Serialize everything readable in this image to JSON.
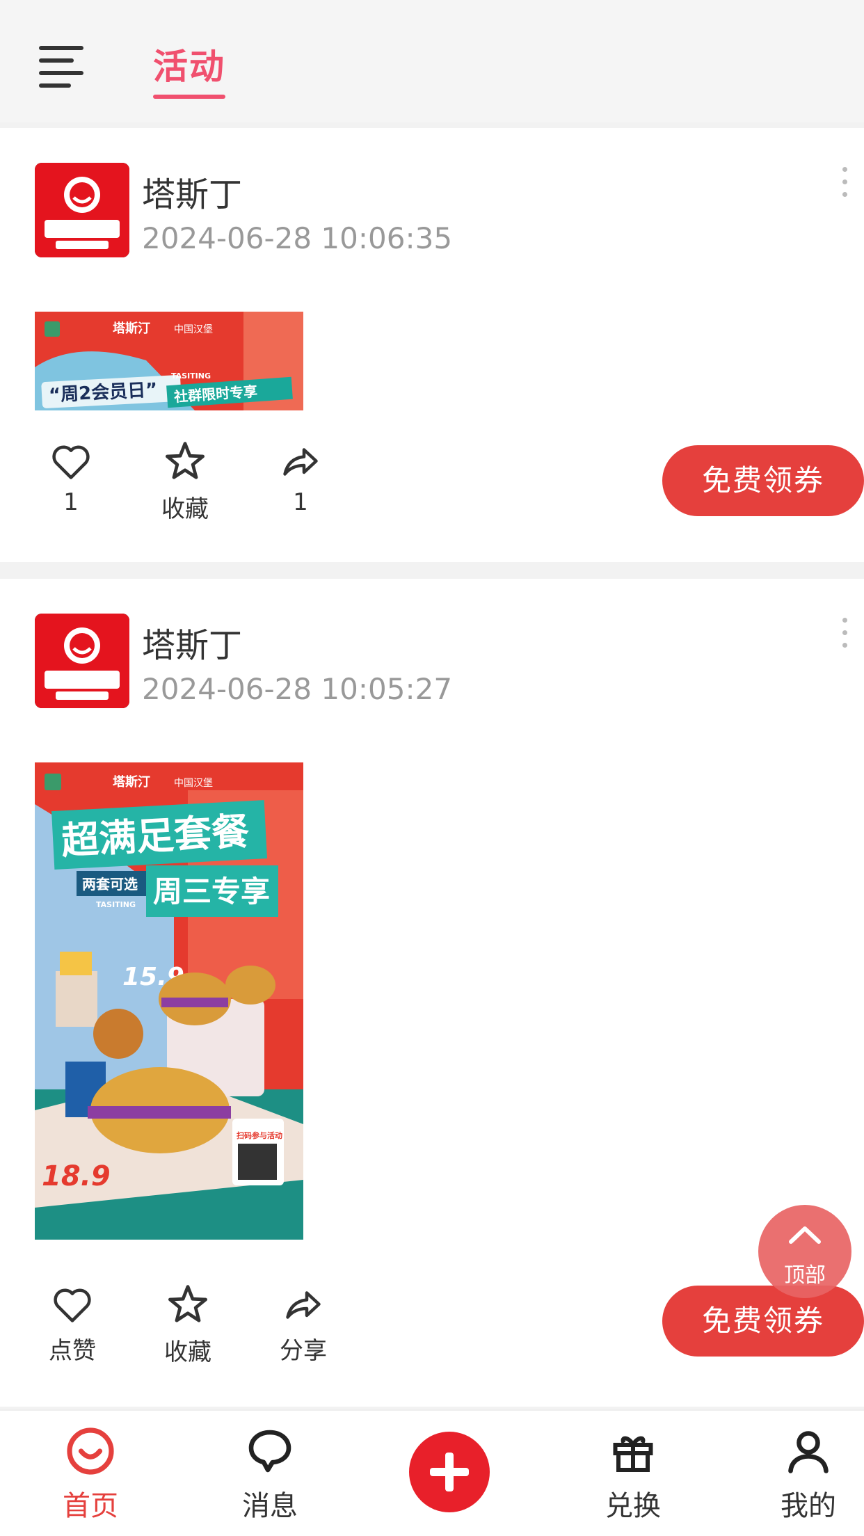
{
  "header": {
    "tab_activity": "活动"
  },
  "posts": [
    {
      "author": "塔斯丁",
      "time": "2024-06-28 10:06:35",
      "image_text": {
        "brand": "塔斯汀",
        "tag": "中国汉堡",
        "headline": "“周2会员日”",
        "sub": "社群限时专享",
        "en": "TASITING"
      },
      "actions": {
        "like": "1",
        "favorite": "收藏",
        "share": "1"
      },
      "coupon_label": "免费领券"
    },
    {
      "author": "塔斯丁",
      "time": "2024-06-28 10:05:27",
      "image_text": {
        "brand": "塔斯汀",
        "tag": "中国汉堡",
        "headline": "超满足套餐",
        "chip": "两套可选",
        "sub": "周三专享",
        "en": "TASITING",
        "price1": "15.9",
        "price2": "18.9",
        "qr_label": "扫码参与活动"
      },
      "actions": {
        "like": "点赞",
        "favorite": "收藏",
        "share": "分享"
      },
      "coupon_label": "免费领券"
    }
  ],
  "float_top_label": "顶部",
  "bottom_nav": [
    {
      "label": "首页",
      "icon": "smile-home-icon",
      "active": true
    },
    {
      "label": "消息",
      "icon": "chat-bubble-icon",
      "active": false
    },
    {
      "label": "兑换",
      "icon": "gift-icon",
      "active": false
    },
    {
      "label": "我的",
      "icon": "user-icon",
      "active": false
    }
  ],
  "colors": {
    "accent": "#f0506e",
    "coupon_red": "#e5403d",
    "plus_red": "#e8202a"
  }
}
